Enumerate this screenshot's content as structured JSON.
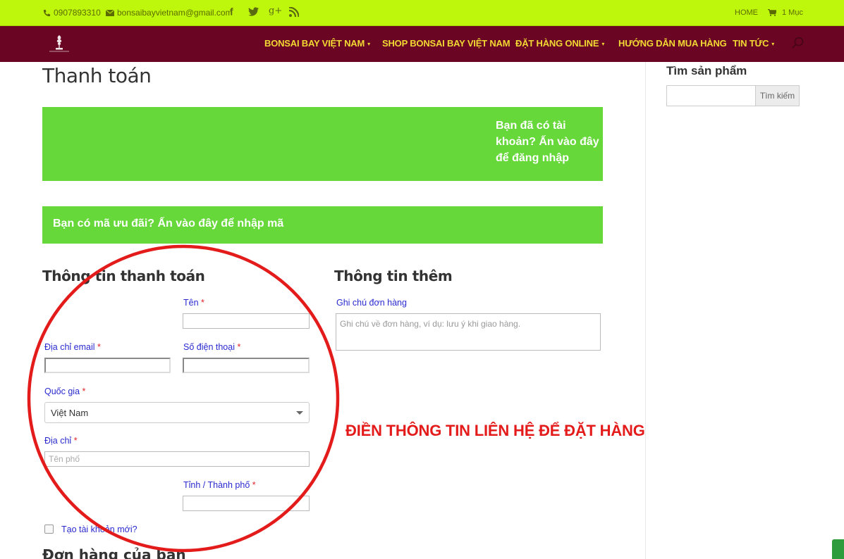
{
  "topbar": {
    "phone": "0907893310",
    "email": "bonsaibayvietnam@gmail.com",
    "social": [
      "facebook-icon",
      "twitter-icon",
      "google-plus-icon",
      "rss-icon"
    ],
    "google_plus_glyph": "g+",
    "home_label": "HOME",
    "cart_label": "1 Mục"
  },
  "nav": {
    "items": [
      {
        "label": "BONSAI BAY VIỆT NAM",
        "dropdown": true
      },
      {
        "label": "SHOP BONSAI BAY VIỆT NAM",
        "dropdown": false
      },
      {
        "label": "ĐẶT HÀNG ONLINE",
        "dropdown": true
      },
      {
        "label": "HƯỚNG DẪN MUA HÀNG",
        "dropdown": false
      },
      {
        "label": "TIN TỨC",
        "dropdown": true
      }
    ],
    "chevron": "▾"
  },
  "page": {
    "title": "Thanh toán",
    "login_notice": "Bạn đã có tài khoản? Ấn vào đây để đăng nhập",
    "coupon_notice": "Bạn có mã ưu đãi? Ấn vào đây để nhập mã"
  },
  "billing": {
    "heading": "Thông tin thanh toán",
    "first_name_label": "Tên",
    "email_label": "Địa chỉ email",
    "phone_label": "Số điện thoại",
    "country_label": "Quốc gia",
    "country_value": "Việt Nam",
    "address_label": "Địa chỉ",
    "address_placeholder": "Tên phố",
    "city_label": "Tỉnh / Thành phố",
    "required_mark": "*",
    "create_account_label": "Tạo tài khoản mới?"
  },
  "additional": {
    "heading": "Thông tin thêm",
    "notes_label": "Ghi chú đơn hàng",
    "notes_placeholder": "Ghi chú về đơn hàng, ví dụ: lưu ý khi giao hàng."
  },
  "order": {
    "heading": "Đơn hàng của bạn"
  },
  "sidebar": {
    "search_heading": "Tìm sản phẩm",
    "search_button": "Tìm kiếm"
  },
  "annotation": {
    "text": "ĐIỀN THÔNG TIN LIÊN HỆ ĐỂ ĐẶT HÀNG",
    "color": "#e31b1b"
  },
  "colors": {
    "topbar": "#bff70c",
    "navbar": "#6a0623",
    "nav_text": "#f2d832",
    "notice": "#66d83a",
    "label": "#2a2ad0"
  }
}
